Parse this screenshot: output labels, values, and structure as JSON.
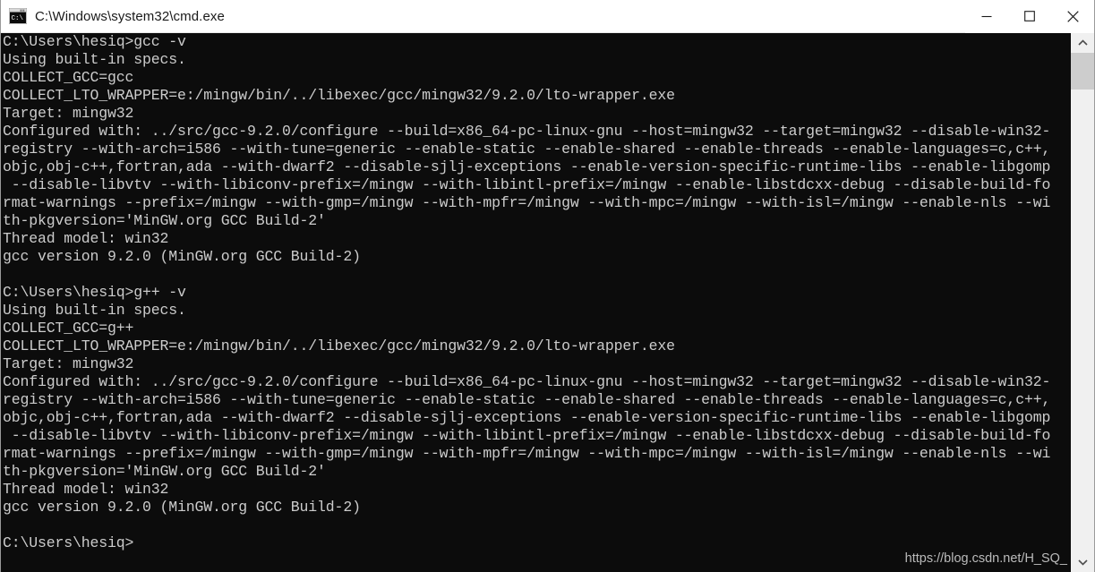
{
  "window": {
    "title": "C:\\Windows\\system32\\cmd.exe",
    "icon": "cmd-console-icon",
    "controls": {
      "minimize_label": "Minimize",
      "maximize_label": "Maximize",
      "close_label": "Close"
    }
  },
  "console": {
    "foreground_color": "#cccccc",
    "background_color": "#0c0c0c",
    "prompt": "C:\\Users\\hesiq>",
    "commands": [
      "gcc -v",
      "g++ -v"
    ],
    "lines": [
      "C:\\Users\\hesiq>gcc -v",
      "Using built-in specs.",
      "COLLECT_GCC=gcc",
      "COLLECT_LTO_WRAPPER=e:/mingw/bin/../libexec/gcc/mingw32/9.2.0/lto-wrapper.exe",
      "Target: mingw32",
      "Configured with: ../src/gcc-9.2.0/configure --build=x86_64-pc-linux-gnu --host=mingw32 --target=mingw32 --disable-win32-registry --with-arch=i586 --with-tune=generic --enable-static --enable-shared --enable-threads --enable-languages=c,c++,objc,obj-c++,fortran,ada --with-dwarf2 --disable-sjlj-exceptions --enable-version-specific-runtime-libs --enable-libgomp --disable-libvtv --with-libiconv-prefix=/mingw --with-libintl-prefix=/mingw --enable-libstdcxx-debug --disable-build-format-warnings --prefix=/mingw --with-gmp=/mingw --with-mpfr=/mingw --with-mpc=/mingw --with-isl=/mingw --enable-nls --with-pkgversion='MinGW.org GCC Build-2'",
      "Thread model: win32",
      "gcc version 9.2.0 (MinGW.org GCC Build-2)",
      "",
      "C:\\Users\\hesiq>g++ -v",
      "Using built-in specs.",
      "COLLECT_GCC=g++",
      "COLLECT_LTO_WRAPPER=e:/mingw/bin/../libexec/gcc/mingw32/9.2.0/lto-wrapper.exe",
      "Target: mingw32",
      "Configured with: ../src/gcc-9.2.0/configure --build=x86_64-pc-linux-gnu --host=mingw32 --target=mingw32 --disable-win32-registry --with-arch=i586 --with-tune=generic --enable-static --enable-shared --enable-threads --enable-languages=c,c++,objc,obj-c++,fortran,ada --with-dwarf2 --disable-sjlj-exceptions --enable-version-specific-runtime-libs --enable-libgomp --disable-libvtv --with-libiconv-prefix=/mingw --with-libintl-prefix=/mingw --enable-libstdcxx-debug --disable-build-format-warnings --prefix=/mingw --with-gmp=/mingw --with-mpfr=/mingw --with-mpc=/mingw --with-isl=/mingw --enable-nls --with-pkgversion='MinGW.org GCC Build-2'",
      "Thread model: win32",
      "gcc version 9.2.0 (MinGW.org GCC Build-2)",
      "",
      "C:\\Users\\hesiq>"
    ],
    "wrapped_text": "C:\\Users\\hesiq>gcc -v\nUsing built-in specs.\nCOLLECT_GCC=gcc\nCOLLECT_LTO_WRAPPER=e:/mingw/bin/../libexec/gcc/mingw32/9.2.0/lto-wrapper.exe\nTarget: mingw32\nConfigured with: ../src/gcc-9.2.0/configure --build=x86_64-pc-linux-gnu --host=mingw32 --target=mingw32 --disable-win32-\nregistry --with-arch=i586 --with-tune=generic --enable-static --enable-shared --enable-threads --enable-languages=c,c++,\nobjc,obj-c++,fortran,ada --with-dwarf2 --disable-sjlj-exceptions --enable-version-specific-runtime-libs --enable-libgomp\n --disable-libvtv --with-libiconv-prefix=/mingw --with-libintl-prefix=/mingw --enable-libstdcxx-debug --disable-build-fo\nrmat-warnings --prefix=/mingw --with-gmp=/mingw --with-mpfr=/mingw --with-mpc=/mingw --with-isl=/mingw --enable-nls --wi\nth-pkgversion='MinGW.org GCC Build-2'\nThread model: win32\ngcc version 9.2.0 (MinGW.org GCC Build-2)\n\nC:\\Users\\hesiq>g++ -v\nUsing built-in specs.\nCOLLECT_GCC=g++\nCOLLECT_LTO_WRAPPER=e:/mingw/bin/../libexec/gcc/mingw32/9.2.0/lto-wrapper.exe\nTarget: mingw32\nConfigured with: ../src/gcc-9.2.0/configure --build=x86_64-pc-linux-gnu --host=mingw32 --target=mingw32 --disable-win32-\nregistry --with-arch=i586 --with-tune=generic --enable-static --enable-shared --enable-threads --enable-languages=c,c++,\nobjc,obj-c++,fortran,ada --with-dwarf2 --disable-sjlj-exceptions --enable-version-specific-runtime-libs --enable-libgomp\n --disable-libvtv --with-libiconv-prefix=/mingw --with-libintl-prefix=/mingw --enable-libstdcxx-debug --disable-build-fo\nrmat-warnings --prefix=/mingw --with-gmp=/mingw --with-mpfr=/mingw --with-mpc=/mingw --with-isl=/mingw --enable-nls --wi\nth-pkgversion='MinGW.org GCC Build-2'\nThread model: win32\ngcc version 9.2.0 (MinGW.org GCC Build-2)\n\nC:\\Users\\hesiq>"
  },
  "watermark": {
    "text": "https://blog.csdn.net/H_SQ_"
  },
  "scrollbar": {
    "up_arrow": "▲",
    "down_arrow": "▼"
  }
}
